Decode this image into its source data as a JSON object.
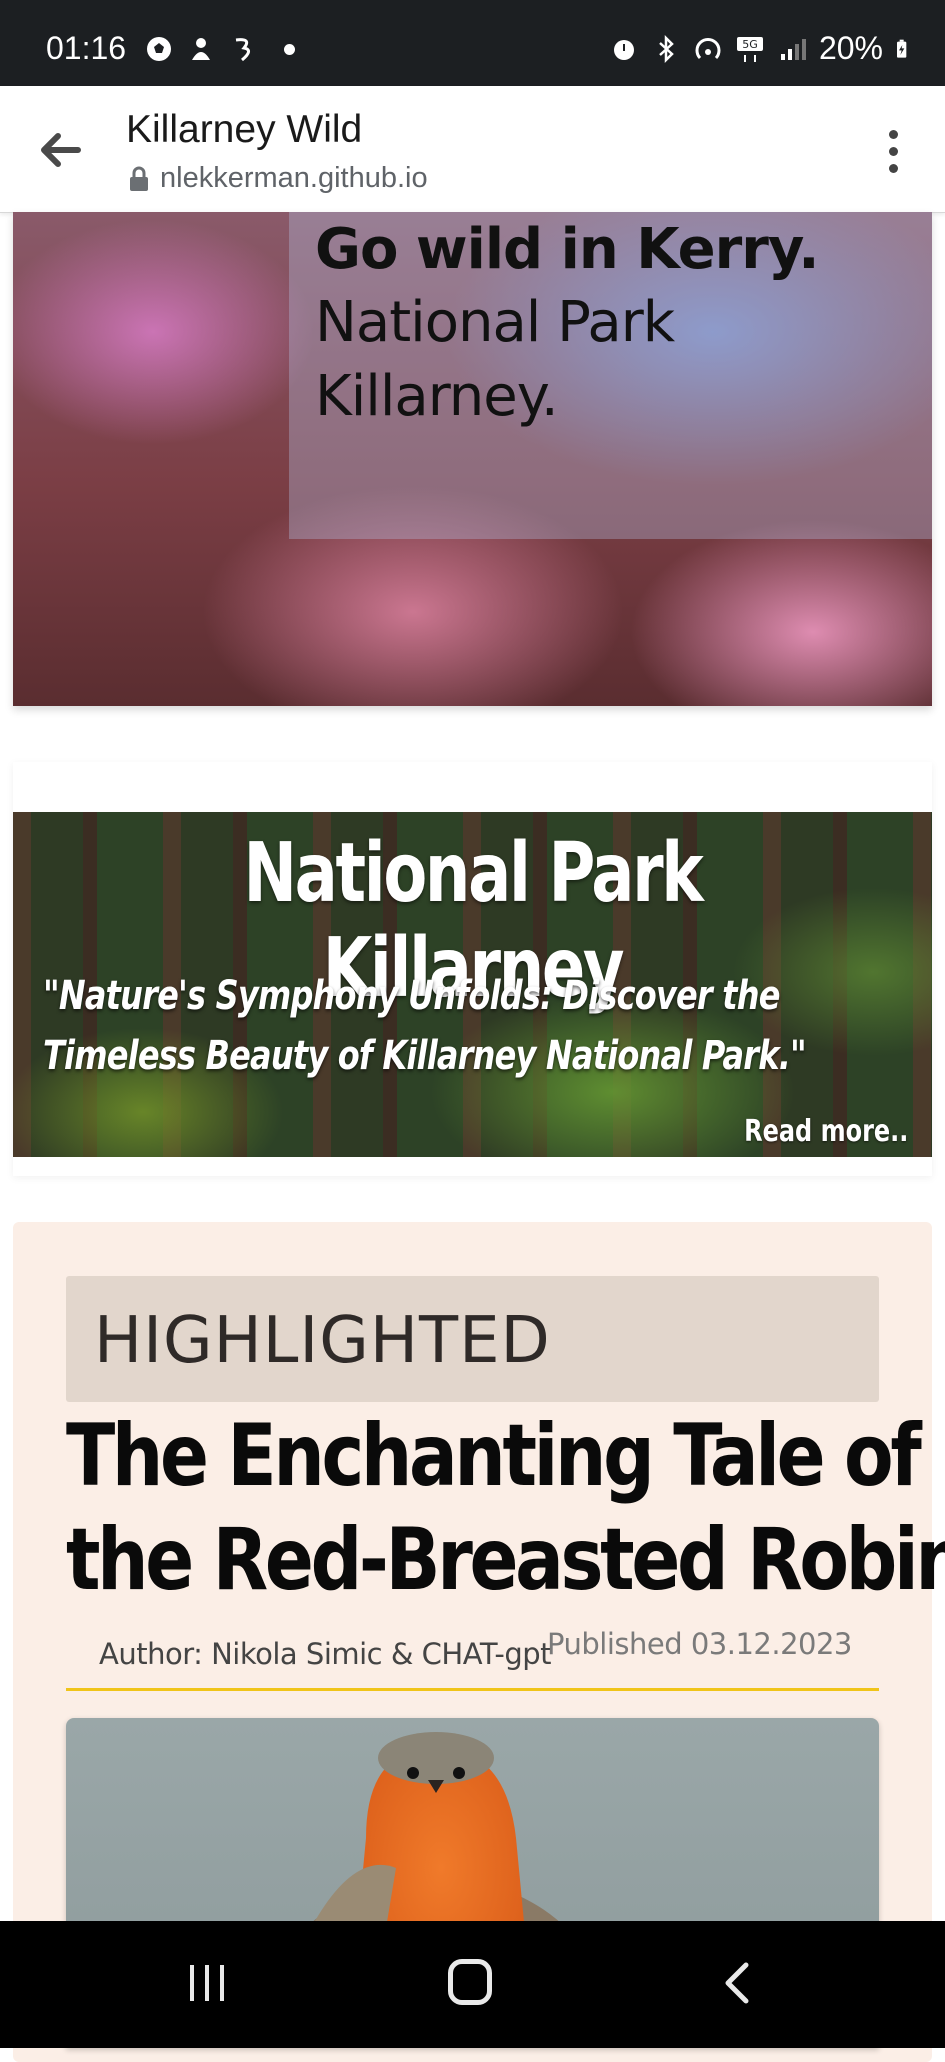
{
  "status_bar": {
    "time": "01:16",
    "left_icons": [
      "soccer-ball-icon",
      "notification-app-icon",
      "carrier-three-icon",
      "dot-icon"
    ],
    "right_icons": [
      "alarm-icon",
      "bluetooth-icon",
      "hotspot-icon",
      "5g-icon",
      "signal-icon"
    ],
    "battery_percent": "20%"
  },
  "browser": {
    "page_title": "Killarney Wild",
    "url": "nlekkerman.github.io"
  },
  "hero": {
    "line1": "Go wild in Kerry.",
    "line2": "National Park",
    "line3": "Killarney."
  },
  "banner": {
    "title": "National Park Killarney",
    "quote_line1": "\"Nature's Symphony Unfolds: Discover the",
    "quote_line2": "Timeless Beauty of Killarney National Park.\"",
    "read_more": "Read more.."
  },
  "article": {
    "badge": "HIGHLIGHTED",
    "title_line1": "The Enchanting Tale of",
    "title_line2": "the Red-Breasted Robin",
    "author": "Author: Nikola Simic & CHAT-gpt",
    "published": "Published 03.12.2023",
    "accent_color": "#f0c419"
  },
  "colors": {
    "status_bar_bg": "#1c1f22",
    "card_bg": "#fbeee6",
    "badge_bg": "#e2d6cc"
  }
}
